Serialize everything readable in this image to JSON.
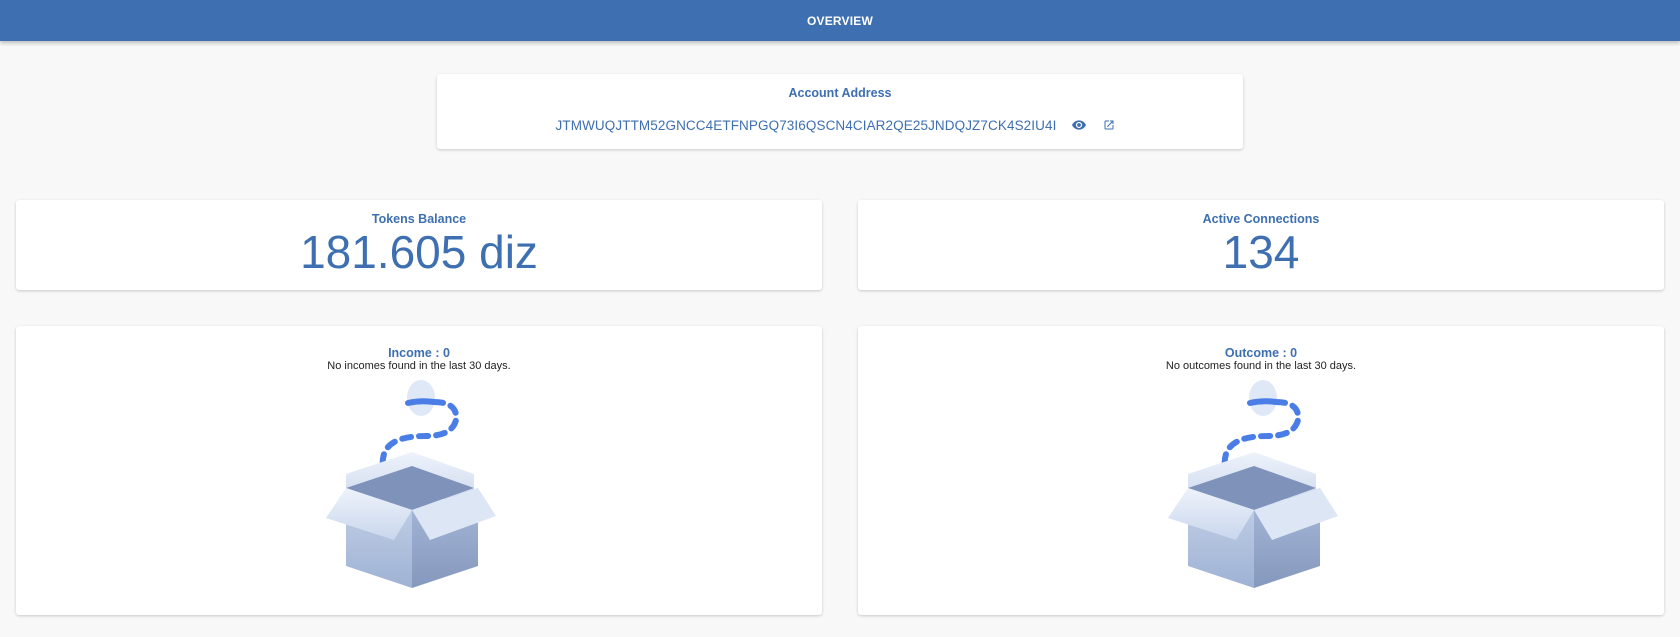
{
  "header": {
    "title": "OVERVIEW"
  },
  "account": {
    "heading": "Account Address",
    "address": "JTMWUQJTTM52GNCC4ETFNPGQ73I6QSCN4CIAR2QE25JNDQJZ7CK4S2IU4I",
    "show_icon": "eye-icon",
    "open_icon": "open-in-new-icon"
  },
  "stats": {
    "balance": {
      "label": "Tokens Balance",
      "value": "181.605 diz"
    },
    "connections": {
      "label": "Active Connections",
      "value": "134"
    }
  },
  "income": {
    "label": "Income",
    "separator": " : ",
    "value": "0",
    "empty_text": "No incomes found in the last 30 days.",
    "illustration": "empty-box-illustration"
  },
  "outcome": {
    "label": "Outcome",
    "separator": " : ",
    "value": "0",
    "empty_text": "No outcomes found in the last 30 days.",
    "illustration": "empty-box-illustration"
  },
  "colors": {
    "primary": "#3d6fb1",
    "background": "#f8f8f8",
    "card": "#ffffff",
    "illustration_accent": "#4a7ee6"
  }
}
